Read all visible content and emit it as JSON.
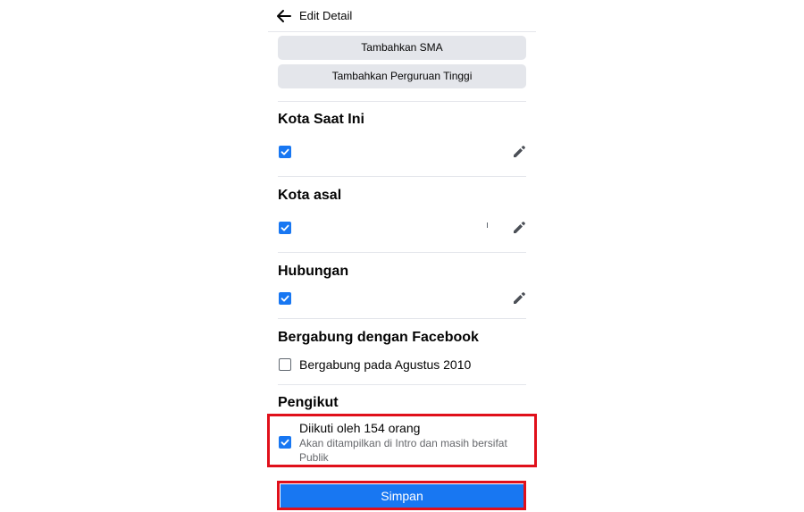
{
  "header": {
    "title": "Edit Detail",
    "back_icon": "arrow-left-icon"
  },
  "education": {
    "add_high_school": "Tambahkan SMA",
    "add_college": "Tambahkan Perguruan Tinggi"
  },
  "current_city": {
    "title": "Kota Saat Ini",
    "checked": true
  },
  "hometown": {
    "title": "Kota asal",
    "checked": true
  },
  "relationship": {
    "title": "Hubungan",
    "checked": true
  },
  "joined": {
    "title": "Bergabung dengan Facebook",
    "label": "Bergabung pada Agustus 2010",
    "checked": false
  },
  "followers": {
    "title": "Pengikut",
    "label": "Diikuti oleh 154 orang",
    "description": "Akan ditampilkan di Intro dan masih bersifat Publik",
    "checked": true
  },
  "footer": {
    "save_label": "Simpan"
  },
  "colors": {
    "accent": "#1877f2",
    "highlight": "#e0101b",
    "button_gray": "#e4e6eb"
  }
}
